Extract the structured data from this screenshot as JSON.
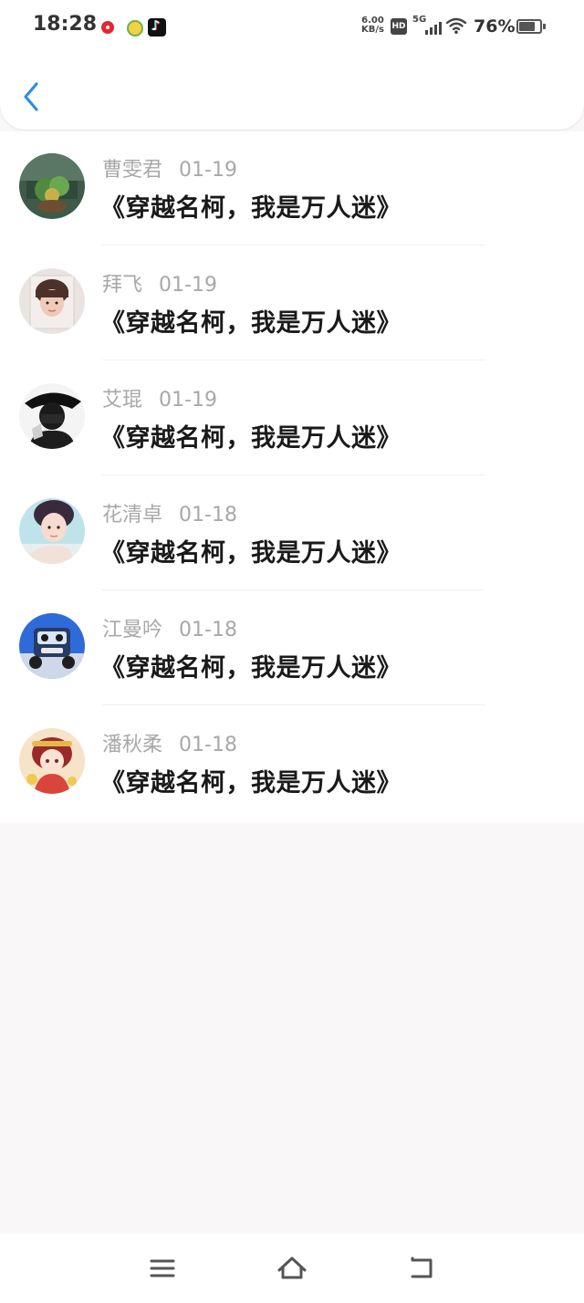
{
  "status_bar": {
    "time": "18:28",
    "net_speed_value": "6.00",
    "net_speed_unit": "KB/s",
    "hd_label": "HD",
    "network_type": "5G",
    "battery_percent": "76%",
    "battery_level": 0.76
  },
  "feed": {
    "items": [
      {
        "name": "曹雯君",
        "date": "01-19",
        "title": "《穿越名柯，我是万人迷》"
      },
      {
        "name": "拜飞",
        "date": "01-19",
        "title": "《穿越名柯，我是万人迷》"
      },
      {
        "name": "艾琨",
        "date": "01-19",
        "title": "《穿越名柯，我是万人迷》"
      },
      {
        "name": "花清卓",
        "date": "01-18",
        "title": "《穿越名柯，我是万人迷》"
      },
      {
        "name": "江曼吟",
        "date": "01-18",
        "title": "《穿越名柯，我是万人迷》"
      },
      {
        "name": "潘秋柔",
        "date": "01-18",
        "title": "《穿越名柯，我是万人迷》"
      }
    ]
  },
  "colors": {
    "accent": "#2f8ee0",
    "name_text": "#a8a8a8",
    "title_text": "#1a1a1a",
    "page_background": "#f9f7f8"
  },
  "icons": {
    "back": "chevron-left-icon",
    "nav_menu": "menu-icon",
    "nav_home": "home-icon",
    "nav_back": "back-icon"
  }
}
